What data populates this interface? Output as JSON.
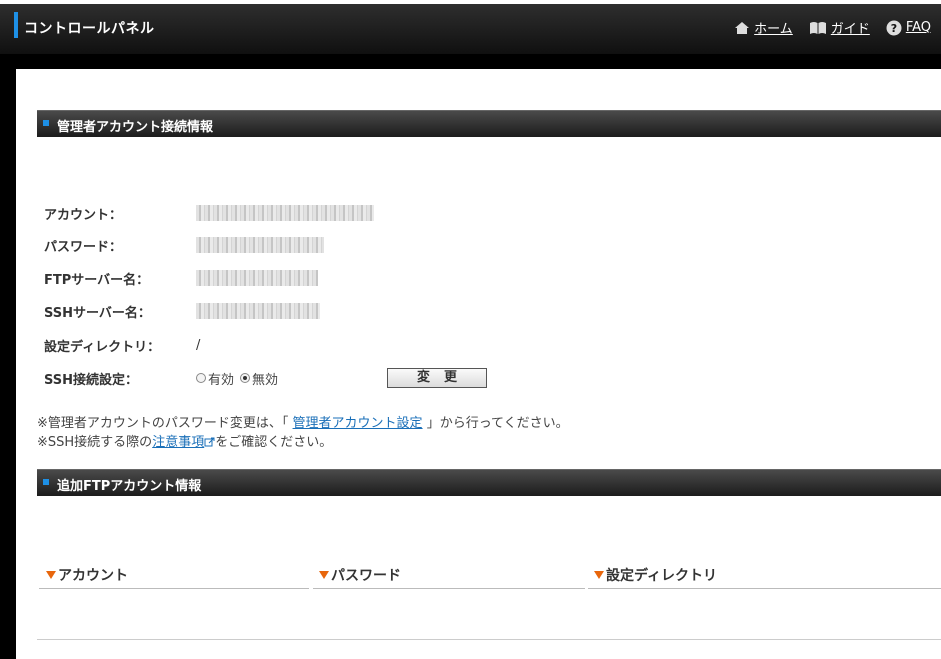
{
  "header": {
    "title": "コントロールパネル",
    "nav": [
      {
        "label": "ホーム",
        "icon": "home-icon"
      },
      {
        "label": "ガイド",
        "icon": "book-icon"
      },
      {
        "label": "FAQ",
        "icon": "help-icon"
      }
    ]
  },
  "admin_section": {
    "title": "管理者アカウント接続情報",
    "rows": [
      {
        "label": "アカウント：",
        "value": ""
      },
      {
        "label": "パスワード：",
        "value": ""
      },
      {
        "label": "FTPサーバー名：",
        "value": ""
      },
      {
        "label": "SSHサーバー名：",
        "value": ""
      },
      {
        "label": "設定ディレクトリ：",
        "value": "/"
      }
    ],
    "ssh": {
      "label": "SSH接続設定：",
      "option_enabled": "有効",
      "option_disabled": "無効",
      "selected": "無効",
      "button_label": "変更"
    },
    "note1_prefix": "※管理者アカウントのパスワード変更は、「",
    "note1_link": "管理者アカウント設定",
    "note1_suffix": "」から行ってください。",
    "note2_prefix": "※SSH接続する際の",
    "note2_link": "注意事項",
    "note2_suffix": "をご確認ください。"
  },
  "ftp_section": {
    "title": "追加FTPアカウント情報",
    "columns": [
      "アカウント",
      "パスワード",
      "設定ディレクトリ"
    ]
  },
  "colors": {
    "accent_blue": "#1e90e6",
    "arrow_orange": "#e8660c",
    "link": "#1a6fb8"
  }
}
